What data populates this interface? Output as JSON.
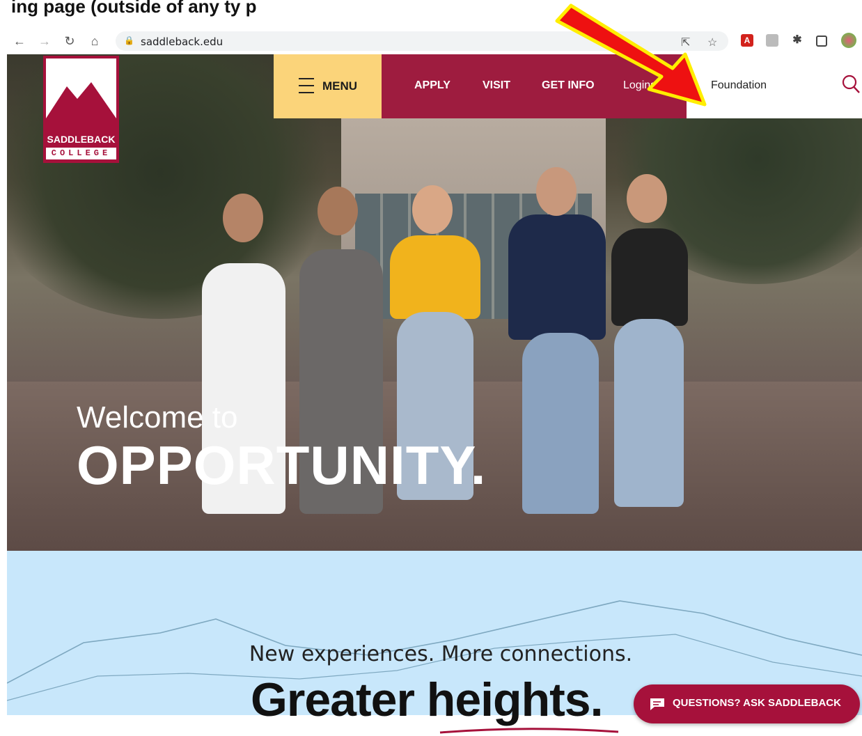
{
  "browser": {
    "url": "saddleback.edu",
    "icons": [
      "back-icon",
      "forward-icon",
      "reload-icon",
      "home-icon",
      "lock-icon",
      "share-icon",
      "star-icon",
      "pdf-extension-icon",
      "extension-icon",
      "puzzle-icon",
      "side-panel-icon",
      "profile-icon"
    ]
  },
  "top_caption": "ing page (outside of any ty    p",
  "logo": {
    "name": "SADDLEBACK",
    "sub": "COLLEGE"
  },
  "nav": {
    "menu_label": "MENU",
    "links": [
      "APPLY",
      "VISIT",
      "GET INFO"
    ],
    "logins_label": "Logins",
    "foundation_label": "Foundation"
  },
  "hero": {
    "line1": "Welcome to",
    "line2": "OPPORTUNITY."
  },
  "section": {
    "tagline": "New experiences. More connections.",
    "headline": "Greater heights."
  },
  "chat": {
    "label": "QUESTIONS? ASK SADDLEBACK"
  },
  "colors": {
    "brand_red": "#a6113b",
    "nav_red": "#9e1c3f",
    "menu_yellow": "#fbd47a",
    "section_blue": "#c8e7fb",
    "annotation_arrow": "#ee1111",
    "annotation_outline": "#ffee00"
  }
}
